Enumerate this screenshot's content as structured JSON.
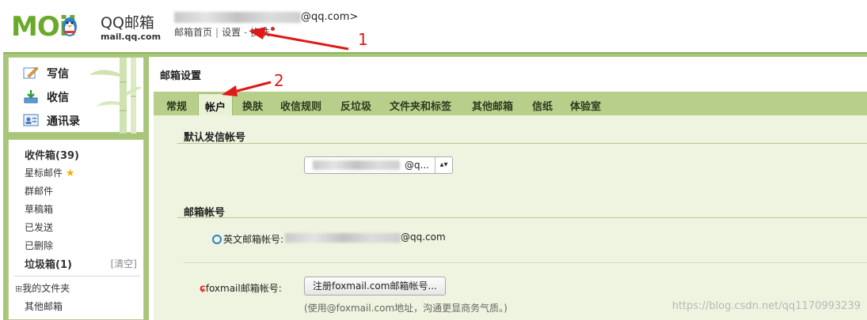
{
  "brand": {
    "logo_text": "MOil",
    "product_name": "QQ邮箱",
    "domain": "mail.qq.com"
  },
  "header": {
    "account_suffix": "@qq.com>",
    "nav": {
      "home_label": "邮箱首页",
      "separator": "|",
      "settings_label": "设置",
      "dash": "-",
      "skin_label": "换肤"
    }
  },
  "annotations": {
    "label_1": "1",
    "label_2": "2"
  },
  "sidebar": {
    "actions": [
      {
        "label": "写信",
        "icon": "pencil-icon"
      },
      {
        "label": "收信",
        "icon": "inbox-download-icon"
      },
      {
        "label": "通讯录",
        "icon": "contact-card-icon"
      }
    ],
    "folders": {
      "inbox": "收件箱(39)",
      "starred": "星标邮件",
      "group": "群邮件",
      "drafts": "草稿箱",
      "sent": "已发送",
      "deleted": "已删除",
      "spam": "垃圾箱(1)",
      "spam_clear": "[清空]",
      "my_folders": "我的文件夹",
      "my_folders_toggle": "⊞",
      "other_mailboxes": "其他邮箱"
    }
  },
  "main": {
    "title": "邮箱设置",
    "tabs": [
      {
        "label": "常规",
        "active": false
      },
      {
        "label": "帐户",
        "active": true
      },
      {
        "label": "换肤",
        "active": false
      },
      {
        "label": "收信规则",
        "active": false
      },
      {
        "label": "反垃圾",
        "active": false
      },
      {
        "label": "文件夹和标签",
        "active": false
      },
      {
        "label": "其他邮箱",
        "active": false
      },
      {
        "label": "信纸",
        "active": false
      },
      {
        "label": "体验室",
        "active": false
      }
    ],
    "default_sender": {
      "title": "默认发信帐号",
      "selected_value": "@q..."
    },
    "mail_accounts": {
      "title": "邮箱帐号",
      "english_label": "英文邮箱帐号:",
      "english_value_suffix": "@qq.com",
      "foxmail_label": "foxmail邮箱帐号:",
      "foxmail_button": "注册foxmail.com邮箱帐号...",
      "foxmail_hint": "(使用@foxmail.com地址，沟通更显商务气质。)"
    }
  },
  "watermark": "https://blog.csdn.net/qq1170993239",
  "colors": {
    "brand_green": "#6aaa2a",
    "frame_green": "#a8c67a",
    "tab_bar": "#b7cf8a",
    "content_bg": "#eef4df",
    "annotation_red": "#e01818"
  }
}
